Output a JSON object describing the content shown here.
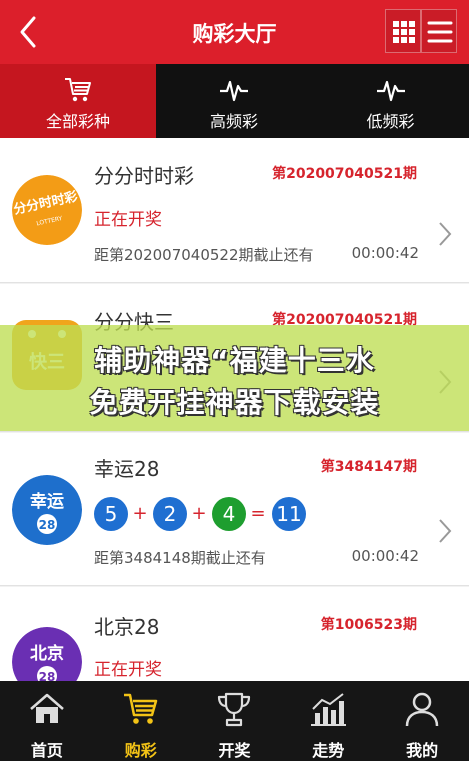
{
  "header": {
    "title": "购彩大厅",
    "back_icon": "chevron-left-icon",
    "grid_icon": "grid-icon",
    "menu_icon": "hamburger-menu-icon",
    "color": "#dc1f2b"
  },
  "tabs": [
    {
      "label": "全部彩种",
      "icon": "cart-icon",
      "active": true
    },
    {
      "label": "高频彩",
      "icon": "pulse-icon",
      "active": false
    },
    {
      "label": "低频彩",
      "icon": "pulse-icon",
      "active": false
    }
  ],
  "games": [
    {
      "name": "分分时时彩",
      "logo_text": "分分时时彩",
      "logo_sub": "LOTTERY",
      "period": "第202007040521期",
      "status": "正在开奖",
      "countdown": "距第202007040522期截止还有",
      "timer": "00:00:42"
    },
    {
      "name": "分分快三",
      "logo_text": "快三",
      "period": "第202007040521期"
    },
    {
      "name": "幸运28",
      "logo_text": "幸运",
      "logo_num": "28",
      "period": "第3484147期",
      "balls": [
        "5",
        "2",
        "4",
        "11"
      ],
      "ops": [
        "+",
        "+",
        "="
      ],
      "countdown": "距第3484148期截止还有",
      "timer": "00:00:42"
    },
    {
      "name": "北京28",
      "logo_text": "北京",
      "logo_num": "28",
      "period": "第1006523期",
      "status": "正在开奖"
    }
  ],
  "banner": {
    "line1": "辅助神器“福建十三水",
    "line2": "免费开挂神器下载安装"
  },
  "bottom_nav": [
    {
      "label": "首页",
      "icon": "home-icon",
      "active": false
    },
    {
      "label": "购彩",
      "icon": "cart-icon",
      "active": true
    },
    {
      "label": "开奖",
      "icon": "trophy-icon",
      "active": false
    },
    {
      "label": "走势",
      "icon": "trend-chart-icon",
      "active": false
    },
    {
      "label": "我的",
      "icon": "user-icon",
      "active": false
    }
  ],
  "colors": {
    "accent_red": "#d6242d",
    "active_nav": "#f3c316",
    "ball_blue": "#1f6fd1",
    "ball_green": "#1e9e2f"
  }
}
